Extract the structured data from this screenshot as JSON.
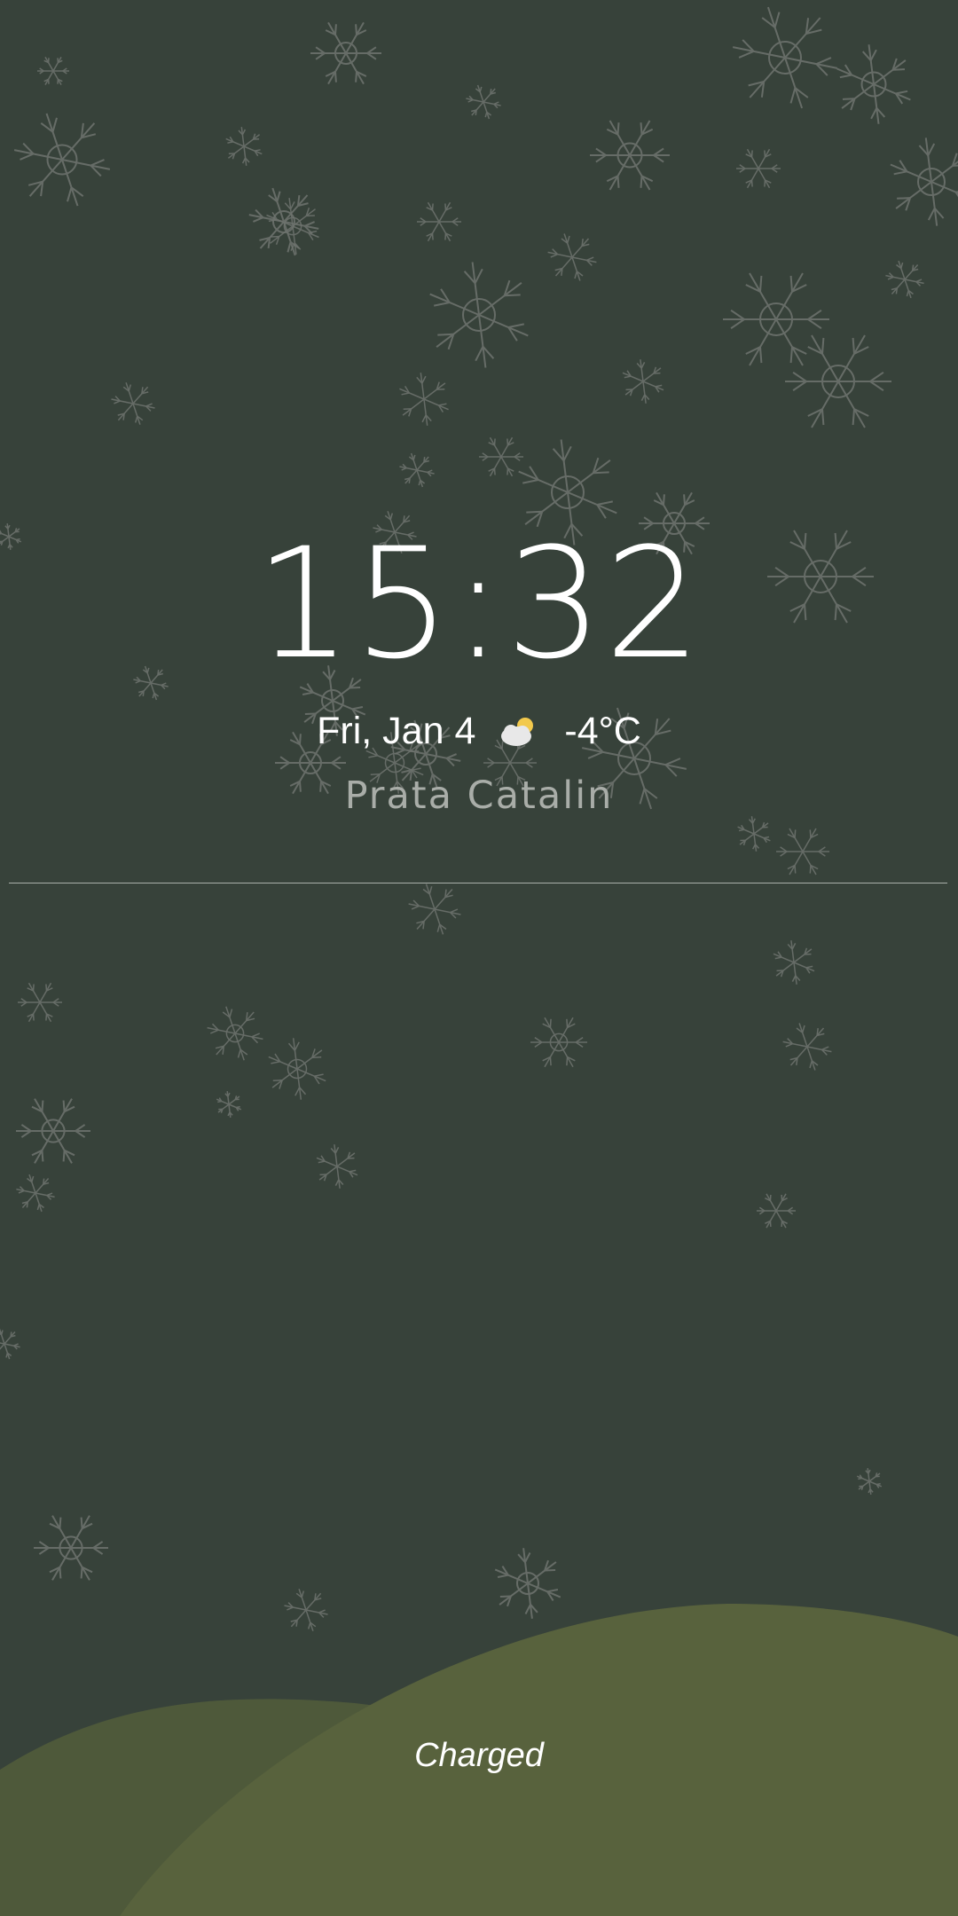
{
  "lockscreen": {
    "time": "15:32",
    "date": "Fri, Jan 4",
    "weather": {
      "icon": "partly-cloudy-icon",
      "temperature": "-4°C"
    },
    "owner_info": "Prata Catalin",
    "charging_status": "Charged"
  },
  "colors": {
    "background": "#37423a",
    "hill_back": "#4e593a",
    "hill_front": "#58623d",
    "snowflake": "#6f746f",
    "text_primary": "#ffffff",
    "text_secondary": "#a9ada8",
    "sun": "#f2c94c",
    "cloud": "#e8e8e8"
  }
}
